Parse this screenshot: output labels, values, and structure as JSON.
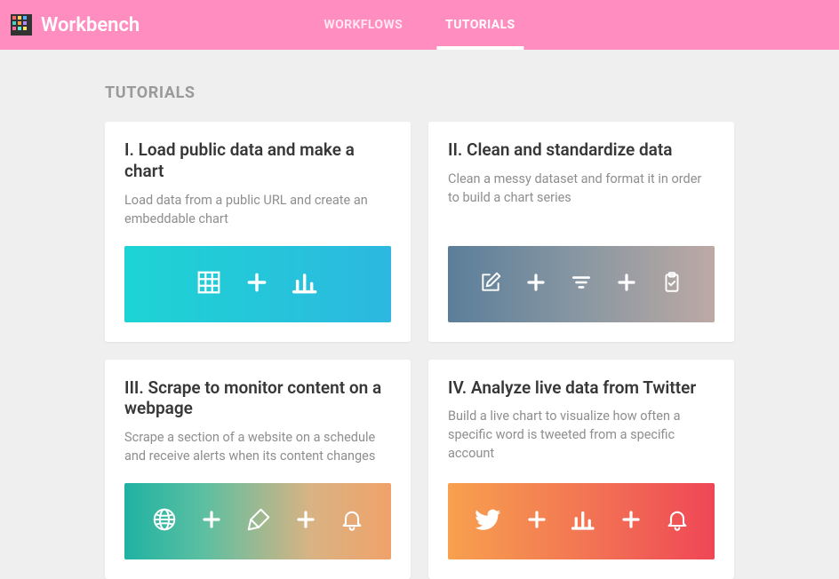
{
  "header": {
    "brand": "Workbench",
    "tabs": [
      {
        "label": "WORKFLOWS",
        "active": false
      },
      {
        "label": "TUTORIALS",
        "active": true
      }
    ]
  },
  "section_heading": "TUTORIALS",
  "tutorials": [
    {
      "title": "I. Load public data and make a chart",
      "desc": "Load data from a public URL and create an embeddable chart",
      "banner": "banner-1",
      "icons": [
        "table-icon",
        "plus-icon",
        "bar-chart-icon"
      ]
    },
    {
      "title": "II. Clean and standardize data",
      "desc": "Clean a messy dataset and format it in order to build a chart series",
      "banner": "banner-2",
      "icons": [
        "edit-icon",
        "plus-icon",
        "filter-icon",
        "plus-icon",
        "clipboard-check-icon"
      ]
    },
    {
      "title": "III. Scrape to monitor content on a webpage",
      "desc": "Scrape a section of a website on a schedule and receive alerts when its content changes",
      "banner": "banner-3",
      "icons": [
        "globe-icon",
        "plus-icon",
        "scrape-icon",
        "plus-icon",
        "bell-icon"
      ]
    },
    {
      "title": "IV. Analyze live data from Twitter",
      "desc": "Build a live chart to visualize how often a specific word is tweeted from a specific account",
      "banner": "banner-4",
      "icons": [
        "twitter-icon",
        "plus-icon",
        "bar-chart-icon",
        "plus-icon",
        "bell-icon"
      ]
    }
  ]
}
